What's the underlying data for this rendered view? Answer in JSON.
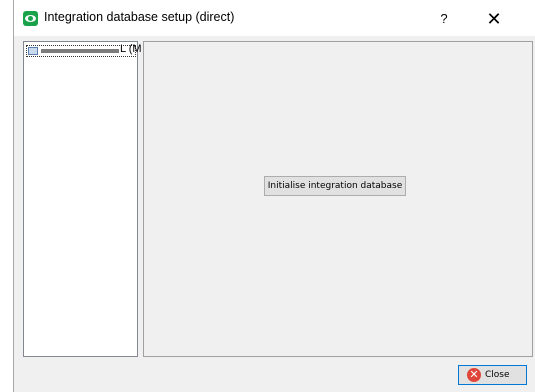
{
  "window": {
    "title": "Integration database setup (direct)",
    "help_label": "?",
    "close_glyph": "✕"
  },
  "tree": {
    "items": [
      {
        "label": "L (M",
        "icon": "database-icon"
      }
    ]
  },
  "content": {
    "init_button_label": "Initialise integration database"
  },
  "footer": {
    "close_label": "Close",
    "close_icon_glyph": "✕"
  }
}
